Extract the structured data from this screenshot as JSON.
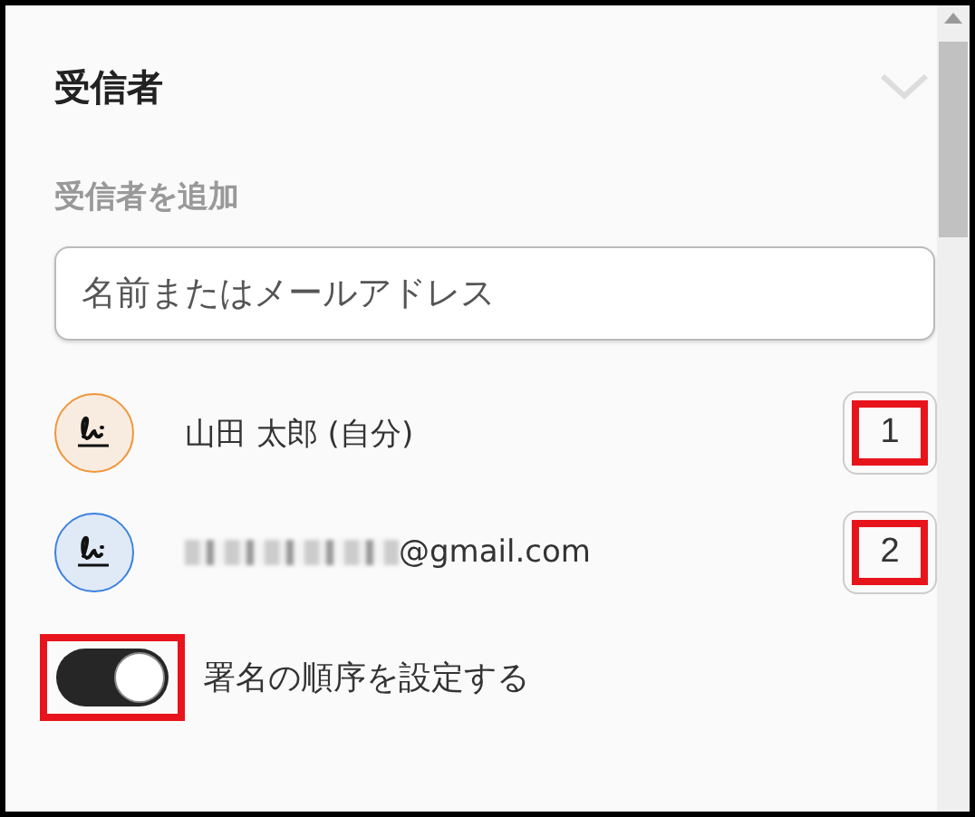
{
  "section": {
    "title": "受信者",
    "expanded": false
  },
  "add_label": "受信者を追加",
  "search": {
    "placeholder": "名前またはメールアドレス"
  },
  "recipients": [
    {
      "name": "山田 太郎 (自分)",
      "redacted": false,
      "color": "#f0953a",
      "order": "1",
      "highlighted": true
    },
    {
      "name": "@gmail.com",
      "redacted": true,
      "color": "#3b82e0",
      "order": "2",
      "highlighted": true
    }
  ],
  "order_toggle": {
    "label": "署名の順序を設定する",
    "on": true,
    "highlighted": true
  }
}
